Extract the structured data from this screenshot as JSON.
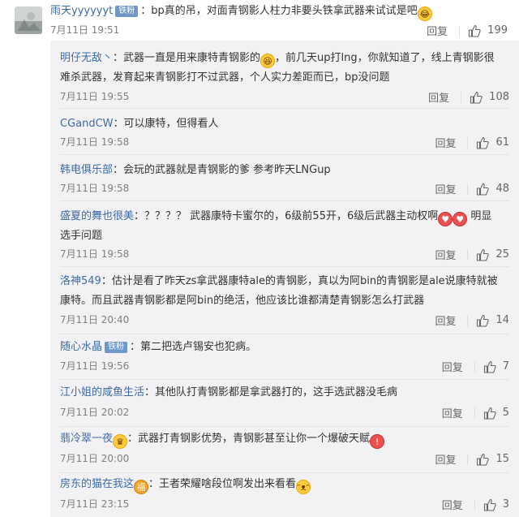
{
  "top_comment": {
    "username": "雨天yyyyyyt",
    "badge": "铁粉",
    "text": "：bp真的吊，对面青钢影人柱力非要头铁拿武器来试试是吧",
    "emoji": "emoji-laugh-tears",
    "time": "7月11日 19:51",
    "reply_label": "回复",
    "likes": "199"
  },
  "replies": [
    {
      "user": "明仔无敌丶",
      "badge": "",
      "text1": "：武器一直是用来康特青钢影的",
      "emoji1": "emoji-laughing",
      "text2": "，前几天up打lng，你就知道了，线上青钢影很",
      "text3": "难杀武器，发育起来青钢影打不过武器，个人实力差距而已，bp没问题",
      "time": "7月11日 19:55",
      "reply_label": "回复",
      "likes": "108"
    },
    {
      "user": "CGandCW",
      "badge": "",
      "text1": "：可以康特，但得看人",
      "time": "7月11日 19:58",
      "reply_label": "回复",
      "likes": "61"
    },
    {
      "user": "韩电俱乐部",
      "badge": "",
      "text1": "：会玩的武器就是青钢影的爹 参考昨天LNGup",
      "time": "7月11日 19:58",
      "reply_label": "回复",
      "likes": "48"
    },
    {
      "user": "盛夏的舞也很美",
      "badge": "",
      "text1": "：？？？？ 武器康特卡蜜尔的，6级前55开，6级后武器主动权啊",
      "emoji1": "emoji-heart-eyes",
      "emoji2": "emoji-heart-eyes",
      "text2": " 明显",
      "text3": "选手问题",
      "time": "7月11日 19:58",
      "reply_label": "回复",
      "likes": "25"
    },
    {
      "user": "洛神549",
      "badge": "",
      "text1": "：估计是看了昨天zs拿武器康特ale的青钢影，真以为阿bin的青钢影是ale说康特就被",
      "text3": "康特。而且武器青钢影都是阿bin的绝活，他应该比谁都清楚青钢影怎么打武器",
      "time": "7月11日 20:40",
      "reply_label": "回复",
      "likes": "14"
    },
    {
      "user": "随心水晶",
      "badge": "铁粉",
      "text1": "：第二把选卢锡安也犯病。",
      "time": "7月11日 19:56",
      "reply_label": "回复",
      "likes": "7"
    },
    {
      "user": "江小姐的咸鱼生活",
      "badge": "",
      "text1": "：其他队打青钢影都是拿武器打的，这手选武器没毛病",
      "time": "7月11日 20:02",
      "reply_label": "回复",
      "likes": "5"
    },
    {
      "user": "翡冷翠一夜",
      "badge": "",
      "user_emoji": "emoji-crown",
      "text1": "：武器打青钢影优势，青钢影甚至让你一个爆破天赋",
      "emoji1": "emoji-angry",
      "time": "7月11日 20:00",
      "reply_label": "回复",
      "likes": "15"
    },
    {
      "user": "房东的猫在我这",
      "badge": "",
      "user_emoji": "emoji-lucky",
      "text1": "：王者荣耀啥段位啊发出来看看",
      "emoji1": "emoji-grin",
      "time": "7月11日 23:15",
      "reply_label": "回复",
      "likes": "3"
    }
  ],
  "colors": {
    "username": "#3d6aa5",
    "badge_bg": "#6f97c8",
    "sub_bg": "#f2f2f5",
    "meta_text": "#808080"
  }
}
